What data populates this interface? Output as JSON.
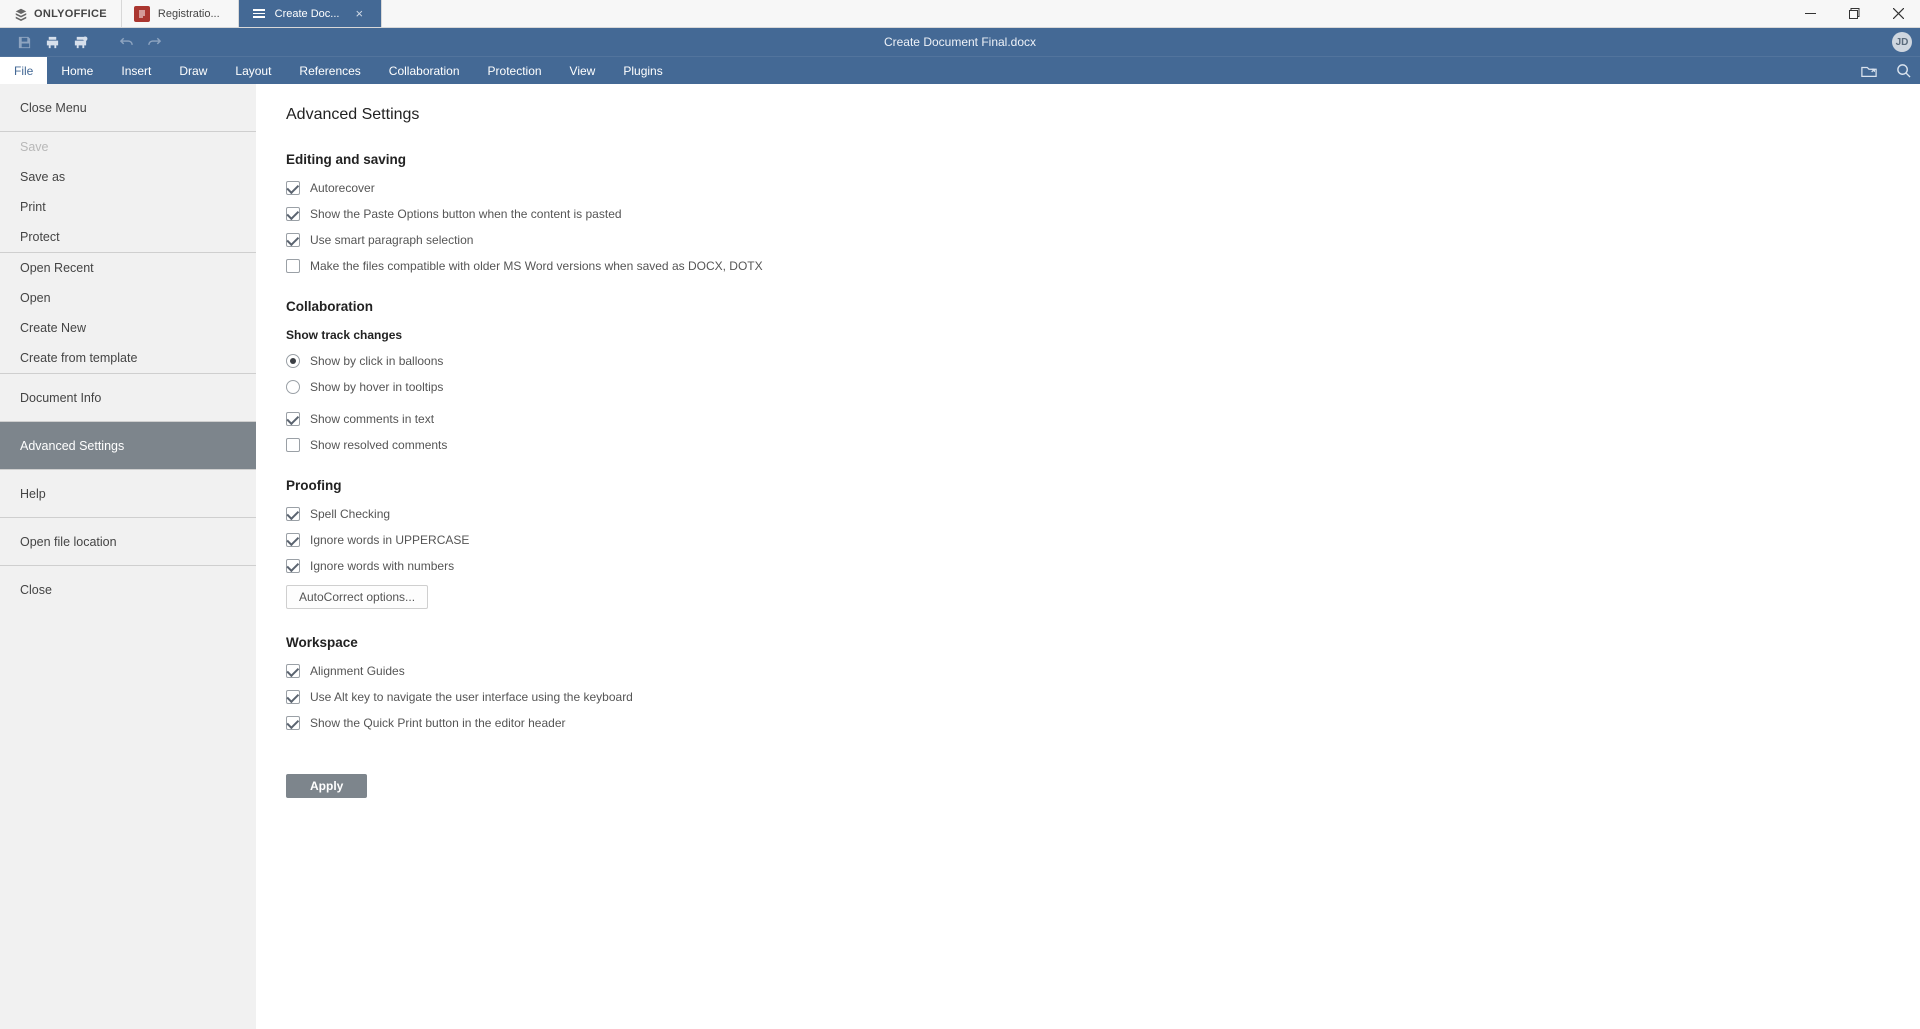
{
  "brand": "ONLYOFFICE",
  "tabs": [
    {
      "label": "Registratio...",
      "icon": "red"
    },
    {
      "label": "Create Doc...",
      "icon": "hamb",
      "active": true
    }
  ],
  "quickbar": {
    "doc_name": "Create Document Final.docx",
    "profile_initials": "JD"
  },
  "ribbon": {
    "items": [
      "File",
      "Home",
      "Insert",
      "Draw",
      "Layout",
      "References",
      "Collaboration",
      "Protection",
      "View",
      "Plugins"
    ],
    "active": "File"
  },
  "fileMenu": {
    "groups": [
      [
        "Close Menu"
      ],
      [
        "Save",
        "Save as",
        "Print",
        "Protect"
      ],
      [
        "Open Recent",
        "Open",
        "Create New",
        "Create from template"
      ],
      [
        "Document Info"
      ],
      [
        "Advanced Settings"
      ],
      [
        "Help"
      ],
      [
        "Open file location"
      ],
      [
        "Close"
      ]
    ],
    "disabled": [
      "Save"
    ],
    "selected": "Advanced Settings"
  },
  "settings": {
    "title": "Advanced Settings",
    "editing": {
      "heading": "Editing and saving",
      "autorecover": {
        "label": "Autorecover",
        "on": true
      },
      "paste_options": {
        "label": "Show the Paste Options button when the content is pasted",
        "on": true
      },
      "smart_para": {
        "label": "Use smart paragraph selection",
        "on": true
      },
      "compat": {
        "label": "Make the files compatible with older MS Word versions when saved as DOCX, DOTX",
        "on": false
      }
    },
    "collab": {
      "heading": "Collaboration",
      "track_heading": "Show track changes",
      "radio_click": {
        "label": "Show by click in balloons",
        "on": true
      },
      "radio_hover": {
        "label": "Show by hover in tooltips",
        "on": false
      },
      "comments": {
        "label": "Show comments in text",
        "on": true
      },
      "resolved": {
        "label": "Show resolved comments",
        "on": false
      }
    },
    "proof": {
      "heading": "Proofing",
      "spell": {
        "label": "Spell Checking",
        "on": true
      },
      "upper": {
        "label": "Ignore words in UPPERCASE",
        "on": true
      },
      "numbers": {
        "label": "Ignore words with numbers",
        "on": true
      },
      "autocorrect_btn": "AutoCorrect options..."
    },
    "workspace": {
      "heading": "Workspace",
      "guides": {
        "label": "Alignment Guides",
        "on": true
      },
      "altkey": {
        "label": "Use Alt key to navigate the user interface using the keyboard",
        "on": true
      },
      "quickprint": {
        "label": "Show the Quick Print button in the editor header",
        "on": true
      }
    },
    "apply_label": "Apply"
  }
}
